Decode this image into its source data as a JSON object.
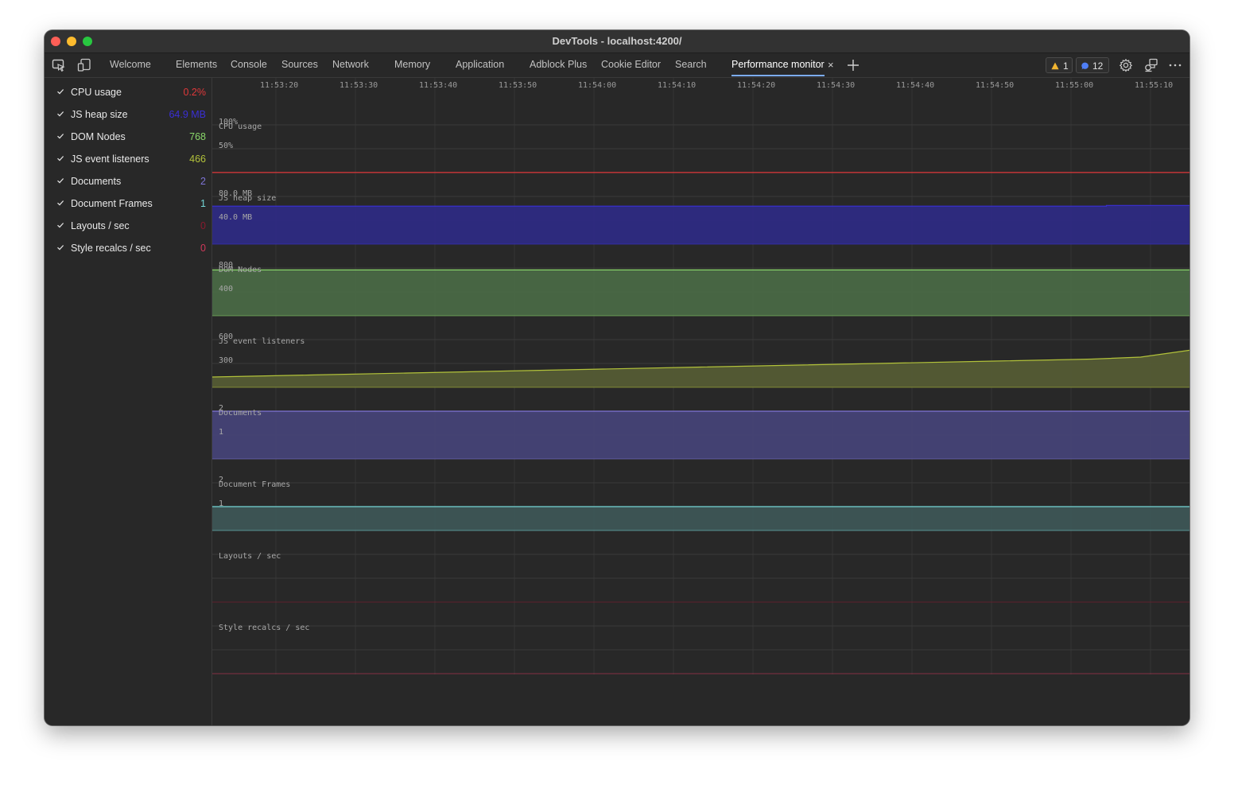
{
  "window": {
    "title": "DevTools - localhost:4200/"
  },
  "tabs": [
    {
      "label": "Welcome",
      "active": false
    },
    {
      "label": "Elements",
      "active": false
    },
    {
      "label": "Console",
      "active": false
    },
    {
      "label": "Sources",
      "active": false
    },
    {
      "label": "Network",
      "active": false
    },
    {
      "label": "Memory",
      "active": false
    },
    {
      "label": "Application",
      "active": false
    },
    {
      "label": "Adblock Plus",
      "active": false
    },
    {
      "label": "Cookie Editor",
      "active": false
    },
    {
      "label": "Search",
      "active": false
    },
    {
      "label": "Performance monitor",
      "active": true
    }
  ],
  "toolbar": {
    "inspect_icon": "inspect-element-icon",
    "device_icon": "device-toolbar-icon",
    "close_tab_glyph": "×",
    "new_tab_icon": "plus-icon",
    "warnings_count": "1",
    "messages_count": "12",
    "settings_icon": "gear-icon",
    "remote_icon": "remote-debugging-icon",
    "more_icon": "more-options-icon"
  },
  "metrics": [
    {
      "label": "CPU usage",
      "value": "0.2%",
      "color": "#e0383a",
      "checked": true
    },
    {
      "label": "JS heap size",
      "value": "64.9 MB",
      "color": "#3a2fd6",
      "checked": true
    },
    {
      "label": "DOM Nodes",
      "value": "768",
      "color": "#8ad86a",
      "checked": true
    },
    {
      "label": "JS event listeners",
      "value": "466",
      "color": "#b2c23a",
      "checked": true
    },
    {
      "label": "Documents",
      "value": "2",
      "color": "#7e74d6",
      "checked": true
    },
    {
      "label": "Document Frames",
      "value": "1",
      "color": "#74d6d6",
      "checked": true
    },
    {
      "label": "Layouts / sec",
      "value": "0",
      "color": "#8a1a2e",
      "checked": true
    },
    {
      "label": "Style recalcs / sec",
      "value": "0",
      "color": "#d0385a",
      "checked": true
    }
  ],
  "chart_data": {
    "type": "area",
    "time_ticks": [
      "11:53:20",
      "11:53:30",
      "11:53:40",
      "11:53:50",
      "11:54:00",
      "11:54:10",
      "11:54:20",
      "11:54:30",
      "11:54:40",
      "11:54:50",
      "11:55:00",
      "11:55:10"
    ],
    "panels": [
      {
        "title": "CPU usage",
        "color": "#e0383a",
        "fill": "#e0383a",
        "ymax": 100,
        "gridlabels": [
          "100%",
          "50%"
        ],
        "x": [
          0,
          1
        ],
        "values": [
          0.2,
          0.2
        ]
      },
      {
        "title": "JS heap size",
        "color": "#3a2fd6",
        "fill": "#2e2a86",
        "ymax": 80,
        "gridlabels": [
          "80.0 MB",
          "40.0 MB"
        ],
        "x": [
          0,
          0.915,
          0.915,
          1
        ],
        "values": [
          63.8,
          63.8,
          64.9,
          64.9
        ]
      },
      {
        "title": "DOM Nodes",
        "color": "#8ad86a",
        "fill": "#4a6b46",
        "ymax": 800,
        "gridlabels": [
          "800",
          "400"
        ],
        "x": [
          0,
          1
        ],
        "values": [
          768,
          768
        ]
      },
      {
        "title": "JS event listeners",
        "color": "#b2c23a",
        "fill": "#565d34",
        "ymax": 600,
        "gridlabels": [
          "600",
          "300"
        ],
        "x": [
          0,
          0.1,
          0.2,
          0.3,
          0.4,
          0.5,
          0.6,
          0.7,
          0.8,
          0.9,
          0.95,
          1
        ],
        "values": [
          130,
          155,
          180,
          205,
          230,
          255,
          280,
          305,
          330,
          355,
          380,
          466
        ]
      },
      {
        "title": "Documents",
        "color": "#7e74d6",
        "fill": "#46447a",
        "ymax": 2,
        "gridlabels": [
          "2",
          "1"
        ],
        "x": [
          0,
          1
        ],
        "values": [
          2,
          2
        ]
      },
      {
        "title": "Document Frames",
        "color": "#74d6d6",
        "fill": "#3e5858",
        "ymax": 2,
        "gridlabels": [
          "2",
          "1"
        ],
        "x": [
          0,
          1
        ],
        "values": [
          1,
          1
        ]
      },
      {
        "title": "Layouts / sec",
        "color": "#8a1a2e",
        "fill": "#8a1a2e",
        "ymax": 10,
        "gridlabels": [],
        "x": [
          0,
          1
        ],
        "values": [
          0,
          0
        ]
      },
      {
        "title": "Style recalcs / sec",
        "color": "#d0385a",
        "fill": "#d0385a",
        "ymax": 10,
        "gridlabels": [],
        "x": [
          0,
          1
        ],
        "values": [
          0,
          0
        ]
      }
    ]
  }
}
